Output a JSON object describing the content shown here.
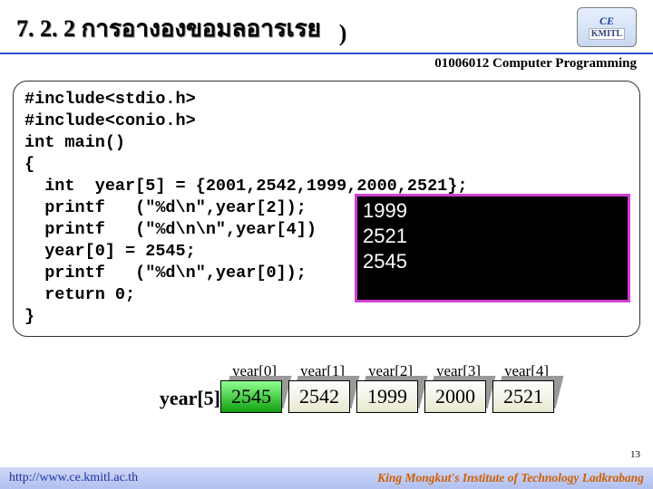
{
  "header": {
    "section": "7. 2. 2 การอางองขอมลอารเรย",
    "paren": ")",
    "course": "01006012 Computer Programming",
    "logo_top": "CE",
    "logo_bot": "KMITL"
  },
  "code": {
    "l0": "#include<stdio.h>",
    "l1": "#include<conio.h>",
    "l2": "int main()",
    "l3": "{",
    "l4": "  int  year[5] = {2001,2542,1999,2000,2521};",
    "l5": "  printf   (\"%d\\n\",year[2]);",
    "l6": "  printf   (\"%d\\n\\n\",year[4])",
    "l7": "  year[0] = 2545;",
    "l8": "  printf   (\"%d\\n\",year[0]);",
    "l9": "  return 0;",
    "l10": "}"
  },
  "output": {
    "o0": "1999",
    "o1": "2521",
    "o2": " ",
    "o3": "2545"
  },
  "array": {
    "name": "year[5]",
    "labels": [
      "year[0]",
      "year[1]",
      "year[2]",
      "year[3]",
      "year[4]"
    ],
    "values": [
      "2545",
      "2542",
      "1999",
      "2000",
      "2521"
    ]
  },
  "footer": {
    "url": "http://www.ce.kmitl.ac.th",
    "org": "King Mongkut's Institute of Technology Ladkrabang",
    "page": "13"
  }
}
